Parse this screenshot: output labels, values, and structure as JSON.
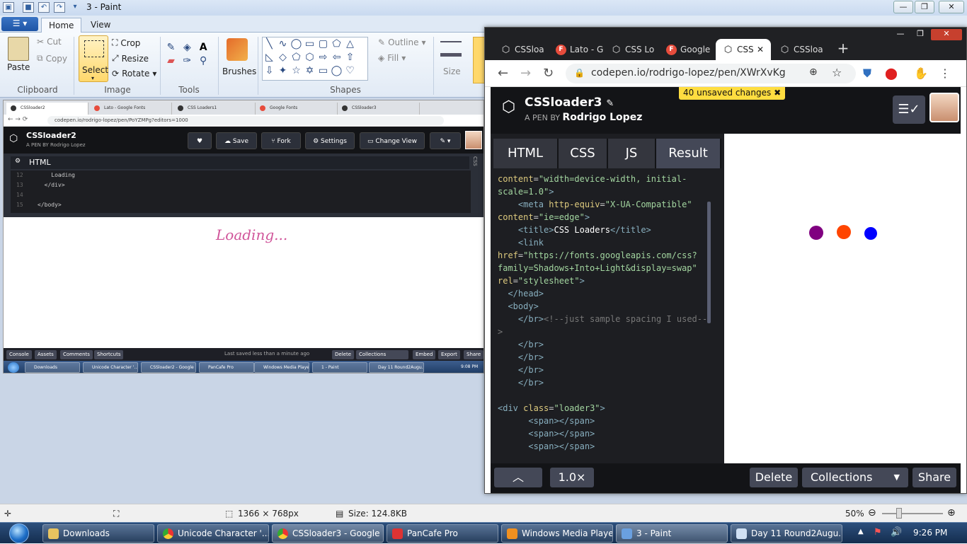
{
  "paint": {
    "title": "3 - Paint",
    "qa_icons": [
      "save-icon",
      "undo-icon",
      "redo-icon",
      "customize-icon"
    ],
    "tabs": {
      "file": "☰ ▾",
      "home": "Home",
      "view": "View"
    },
    "clipboard": {
      "paste": "Paste",
      "cut": "Cut",
      "copy": "Copy",
      "label": "Clipboard"
    },
    "image": {
      "select": "Select",
      "crop": "Crop",
      "resize": "Resize",
      "rotate": "Rotate",
      "label": "Image"
    },
    "tools": {
      "label": "Tools"
    },
    "brushes": {
      "label": "Brushes"
    },
    "shapes": {
      "outline": "Outline",
      "fill": "Fill",
      "label": "Shapes"
    },
    "size": {
      "label": "Size"
    },
    "status": {
      "dimensions": "1366 × 768px",
      "size": "Size: 124.8KB",
      "zoom": "50%"
    }
  },
  "embedded": {
    "tabs": [
      "CSSloader2",
      "Lato - Google Fonts",
      "CSS Loaders1",
      "Google Fonts",
      "CSSloader3"
    ],
    "url": "codepen.io/rodrigo-lopez/pen/PoYZMPg?editors=1000",
    "pen_title": "CSSloader2",
    "pen_by": "A PEN BY Rodrigo Lopez",
    "buttons": {
      "save": "Save",
      "fork": "Fork",
      "settings": "Settings",
      "change_view": "Change View"
    },
    "editor_header": "HTML",
    "side_label": "CSS",
    "code": [
      {
        "n": "12",
        "t": "    Loading"
      },
      {
        "n": "13",
        "t": "  </div>"
      },
      {
        "n": "14",
        "t": ""
      },
      {
        "n": "15",
        "t": "</body>"
      }
    ],
    "loading_text": "Loading...",
    "bottom": {
      "console": "Console",
      "assets": "Assets",
      "comments": "Comments",
      "shortcuts": "Shortcuts",
      "saved": "Last saved less than a minute ago",
      "delete": "Delete",
      "collections": "Collections",
      "embed": "Embed",
      "export": "Export",
      "share": "Share"
    },
    "taskbar": [
      "Downloads",
      "Unicode Character '...",
      "CSSloader2 - Google ...",
      "PanCafe Pro",
      "Windows Media Player",
      "1 - Paint",
      "Day 11 Round2Augu..."
    ],
    "clock": "9:08 PM"
  },
  "chrome": {
    "tabs": [
      {
        "label": "CSSloa",
        "fav": "codepen"
      },
      {
        "label": "Lato - G",
        "fav": "F"
      },
      {
        "label": "CSS Lo",
        "fav": "codepen"
      },
      {
        "label": "Google",
        "fav": "F"
      },
      {
        "label": "CSS",
        "fav": "codepen"
      },
      {
        "label": "CSSloa",
        "fav": "codepen"
      }
    ],
    "url": "codepen.io/rodrigo-lopez/pen/XWrXvKg"
  },
  "codepen": {
    "title": "CSSloader3",
    "by_prefix": "A PEN BY",
    "author": "Rodrigo Lopez",
    "unsaved": "40 unsaved changes",
    "tabs": [
      "HTML",
      "CSS",
      "JS",
      "Result"
    ],
    "footer": {
      "zoom": "1.0×",
      "delete": "Delete",
      "collections": "Collections",
      "share": "Share"
    },
    "dots": [
      "#800080",
      "#ff4500",
      "#0000ff"
    ]
  },
  "taskbar": {
    "items": [
      "Downloads",
      "Unicode Character '...",
      "CSSloader3 - Google ...",
      "PanCafe Pro",
      "Windows Media Player",
      "3 - Paint",
      "Day 11 Round2Augu..."
    ],
    "clock": "9:26 PM"
  }
}
